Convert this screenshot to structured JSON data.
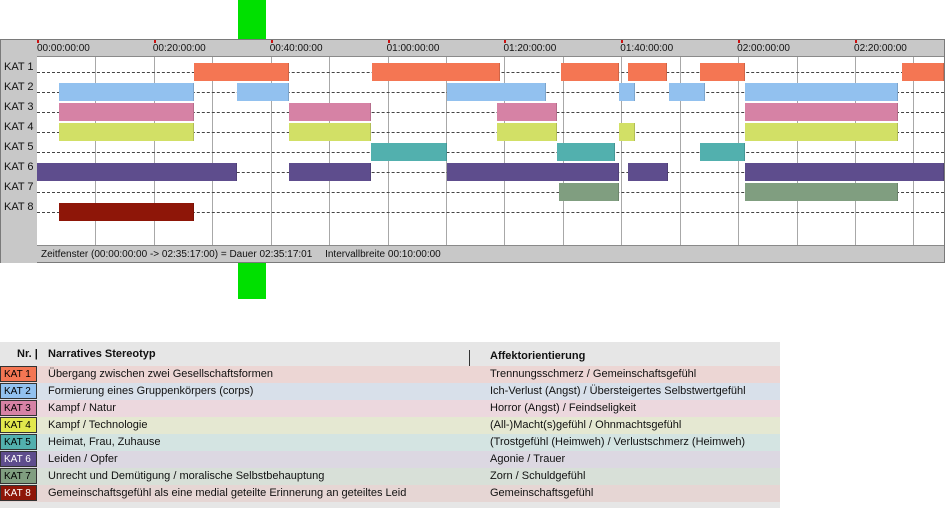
{
  "timeline": {
    "ticks": [
      "00:00:00:00",
      "00:20:00:00",
      "00:40:00:00",
      "01:00:00:00",
      "01:20:00:00",
      "01:40:00:00",
      "02:00:00:00",
      "02:20:00:00"
    ],
    "rows": [
      "KAT 1",
      "KAT 2",
      "KAT 3",
      "KAT 4",
      "KAT 5",
      "KAT 6",
      "KAT 7",
      "KAT 8"
    ],
    "status_window": "Zeitfenster (00:00:00:00 -> 02:35:17:00) = Dauer 02:35:17:01",
    "status_interval": "Intervallbreite 00:10:00:00",
    "total_minutes": 155.28,
    "categories": [
      {
        "id": "KAT 1",
        "color": "#f47653",
        "segments": [
          [
            26.8,
            43.1
          ],
          [
            57.3,
            79.2
          ],
          [
            89.6,
            99.6
          ],
          [
            101.2,
            107.9
          ],
          [
            113.5,
            121.1
          ],
          [
            148,
            155.28
          ]
        ]
      },
      {
        "id": "KAT 2",
        "color": "#92c1ef",
        "segments": [
          [
            3.8,
            26.9
          ],
          [
            34.2,
            43.2
          ],
          [
            70.1,
            87.1
          ],
          [
            99.6,
            102.3
          ],
          [
            108.1,
            114.3
          ],
          [
            121.1,
            147.4
          ]
        ]
      },
      {
        "id": "KAT 3",
        "color": "#d682a5",
        "segments": [
          [
            3.8,
            26.9
          ],
          [
            43.1,
            57.1
          ],
          [
            78.7,
            89.0
          ],
          [
            121.1,
            147.4
          ]
        ]
      },
      {
        "id": "KAT 4",
        "color": "#d2e066",
        "segments": [
          [
            3.8,
            26.9
          ],
          [
            43.1,
            57.1
          ],
          [
            78.7,
            89.0
          ],
          [
            99.6,
            102.3
          ],
          [
            121.1,
            147.4
          ]
        ]
      },
      {
        "id": "KAT 5",
        "color": "#52b0ae",
        "segments": [
          [
            57.1,
            70.1
          ],
          [
            89.0,
            99.0
          ],
          [
            113.5,
            121.1
          ]
        ]
      },
      {
        "id": "KAT 6",
        "color": "#5e4d8d",
        "segments": [
          [
            0,
            34.2
          ],
          [
            43.1,
            57.1
          ],
          [
            70.1,
            99.6
          ],
          [
            101.2,
            108.0
          ],
          [
            121.1,
            155.28
          ]
        ]
      },
      {
        "id": "KAT 7",
        "color": "#809e80",
        "segments": [
          [
            89.4,
            99.6
          ],
          [
            121.1,
            147.4
          ]
        ]
      },
      {
        "id": "KAT 8",
        "color": "#8e1608",
        "segments": [
          [
            3.8,
            26.9
          ]
        ]
      }
    ]
  },
  "legend": {
    "header_nr": "Nr. |",
    "header_stereotyp": "Narratives Stereotyp",
    "header_affekt": "Affektorientierung",
    "rows": [
      {
        "badge": "KAT 1",
        "stereotyp": "Übergang zwischen zwei Gesellschaftsformen",
        "affekt": "Trennungsschmerz / Gemeinschaftsgefühl",
        "color": "#f47653",
        "bg": "#ecd6d4",
        "text": "#000000"
      },
      {
        "badge": "KAT 2",
        "stereotyp": "Formierung eines Gruppenkörpers (corps)",
        "affekt": "Ich-Verlust (Angst) / Übersteigertes Selbstwertgefühl",
        "color": "#92c1ef",
        "bg": "#d8e0ea",
        "text": "#000000"
      },
      {
        "badge": "KAT 3",
        "stereotyp": "Kampf / Natur",
        "affekt": "Horror (Angst) / Feindseligkeit",
        "color": "#d682a5",
        "bg": "#ecd8de",
        "text": "#000000"
      },
      {
        "badge": "KAT 4",
        "stereotyp": "Kampf / Technologie",
        "affekt": "(All-)Macht(s)gefühl / Ohnmachtsgefühl",
        "color": "#e2e84c",
        "bg": "#e5e8d2",
        "text": "#000000"
      },
      {
        "badge": "KAT 5",
        "stereotyp": "Heimat, Frau, Zuhause",
        "affekt": "(Trostgefühl (Heimweh) / Verlustschmerz (Heimweh)",
        "color": "#52b0ae",
        "bg": "#d4e4e2",
        "text": "#000000"
      },
      {
        "badge": "KAT 6",
        "stereotyp": "Leiden / Opfer",
        "affekt": "Agonie / Trauer",
        "color": "#5e4d8d",
        "bg": "#dcd8e2",
        "text": "#ffffff"
      },
      {
        "badge": "KAT 7",
        "stereotyp": "Unrecht und Demütigung / moralische Selbstbehauptung",
        "affekt": "Zorn / Schuldgefühl",
        "color": "#809e80",
        "bg": "#d8e0d8",
        "text": "#000000"
      },
      {
        "badge": "KAT 8",
        "stereotyp": "Gemeinschaftsgefühl als eine medial geteilte Erinnerung an geteiltes Leid",
        "affekt": "Gemeinschaftsgefühl",
        "color": "#8e1608",
        "bg": "#e6d6d4",
        "text": "#ffffff"
      }
    ]
  }
}
